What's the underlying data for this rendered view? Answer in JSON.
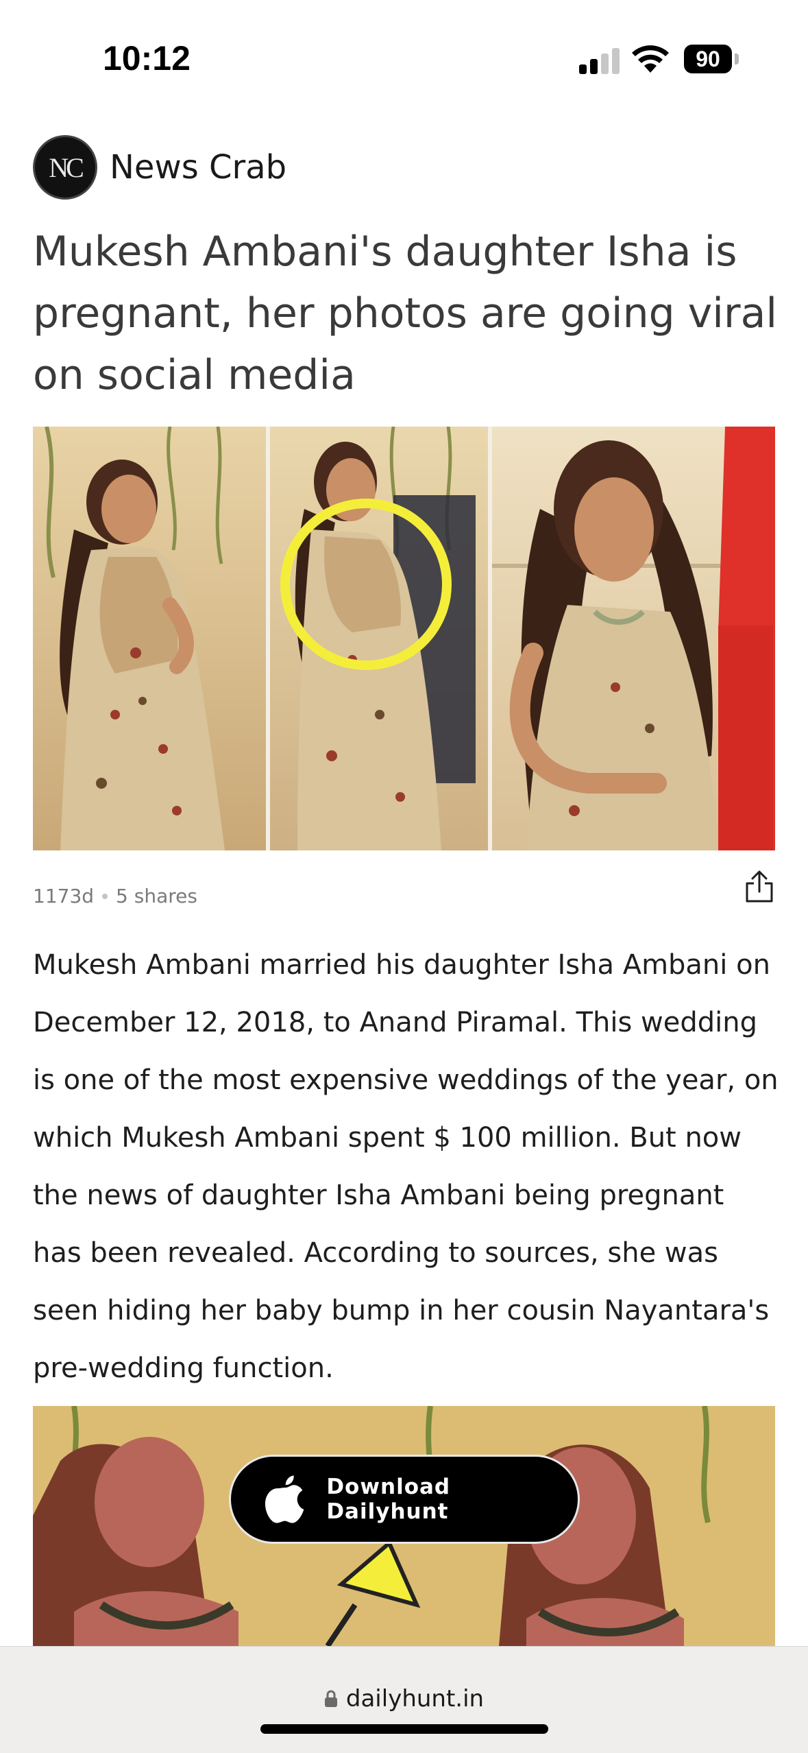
{
  "status_bar": {
    "time": "10:12",
    "battery": "90"
  },
  "source": {
    "logo_text": "NC",
    "name": "News Crab"
  },
  "article": {
    "headline": "Mukesh Ambani's daughter Isha is pregnant, her photos are going viral on social media",
    "age": "1173d",
    "shares": "5 shares",
    "body": "Mukesh Ambani married his daughter Isha Ambani on December 12, 2018, to Anand Piramal. This wedding is one of the most expensive weddings of the year, on which Mukesh Ambani spent $ 100 million. But now the news of daughter Isha Ambani being pregnant has been revealed. According to sources, she was seen hiding her baby bump in her cousin Nayantara's pre-wedding function."
  },
  "cta": {
    "download_label": "Download Dailyhunt"
  },
  "browser": {
    "url": "dailyhunt.in"
  },
  "colors": {
    "highlight_circle": "#f4ee3b",
    "red_panel": "#e0302a"
  }
}
